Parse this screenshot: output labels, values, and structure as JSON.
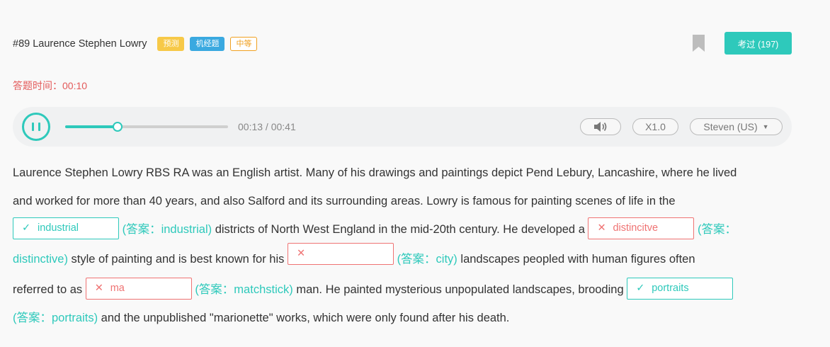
{
  "header": {
    "title": "#89 Laurence Stephen Lowry",
    "tags": [
      "预测",
      "机经题",
      "中等"
    ],
    "passed_button": "考过 (197)"
  },
  "timer": "答题时间：00:10",
  "player": {
    "time": "00:13 / 00:41",
    "progress": 0.32,
    "speed": "X1.0",
    "voice": "Steven (US)"
  },
  "passage": {
    "t1": "Laurence Stephen Lowry RBS RA was an English artist. Many of his drawings and paintings depict Pend Lebury, Lancashire, where he lived",
    "t2": "and worked for more than 40 years, and also Salford and its surrounding areas. Lowry is famous for painting scenes of life in the",
    "t3": " districts of North West England in the mid-20th century. He developed a ",
    "t4": " style of painting and is best known for his ",
    "t5": " landscapes peopled with human figures often",
    "t6": "referred to as ",
    "t7": " man. He painted mysterious unpopulated landscapes, brooding ",
    "t8": " and the unpublished \"marionette\" works, which were only found after his death."
  },
  "blanks": [
    {
      "value": "industrial",
      "status": "correct",
      "answer": "(答案：industrial)"
    },
    {
      "value": "distincitve",
      "status": "wrong",
      "answer": "(答案：",
      "answer_cont": "distinctive)"
    },
    {
      "value": "",
      "status": "wrong",
      "answer": "(答案：city)"
    },
    {
      "value": "ma",
      "status": "wrong",
      "answer": "(答案：matchstick)"
    },
    {
      "value": "portraits",
      "status": "correct",
      "answer": "(答案：portraits)"
    }
  ],
  "marks": {
    "correct": "✓",
    "wrong": "✕"
  },
  "colors": {
    "accent": "#2ec9bb",
    "error": "#e35a5a"
  }
}
